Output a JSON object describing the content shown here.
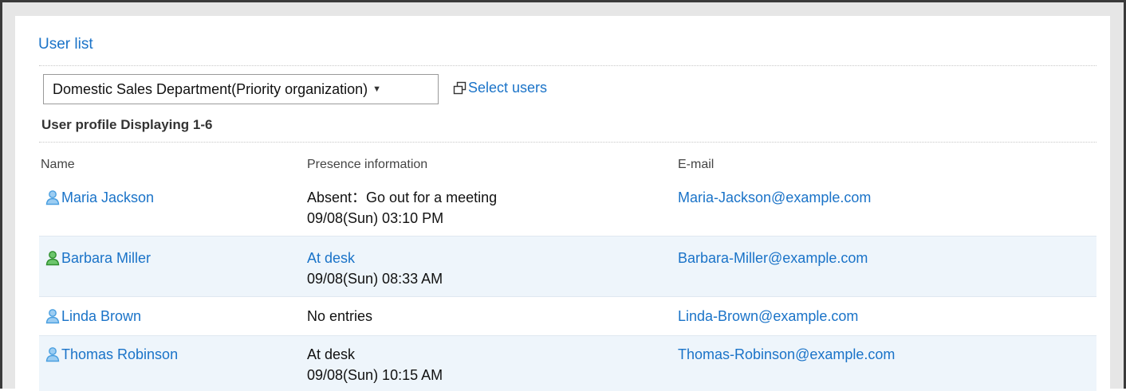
{
  "header": {
    "title": "User list"
  },
  "toolbar": {
    "organization_select": "Domestic Sales Department(Priority organization)",
    "select_users_label": "Select users"
  },
  "subheading": "User profile Displaying 1-6",
  "columns": {
    "name": "Name",
    "presence": "Presence information",
    "email": "E-mail"
  },
  "users": [
    {
      "name": "Maria Jackson",
      "presence": "Absent：Go out for a meeting",
      "presence_time": "09/08(Sun) 03:10 PM",
      "email": "Maria-Jackson@example.com",
      "status_color": "#4a9fe0"
    },
    {
      "name": "Barbara Miller",
      "presence": "At desk",
      "presence_time": "09/08(Sun) 08:33 AM",
      "email": "Barbara-Miller@example.com",
      "status_color": "#3aa33a"
    },
    {
      "name": "Linda Brown",
      "presence": "No entries",
      "presence_time": "",
      "email": "Linda-Brown@example.com",
      "status_color": "#4a9fe0"
    },
    {
      "name": "Thomas Robinson",
      "presence": "At desk",
      "presence_time": "09/08(Sun) 10:15 AM",
      "email": "Thomas-Robinson@example.com",
      "status_color": "#4a9fe0"
    }
  ],
  "colors": {
    "link": "#1a73c8",
    "row_alt": "#eef5fb"
  }
}
